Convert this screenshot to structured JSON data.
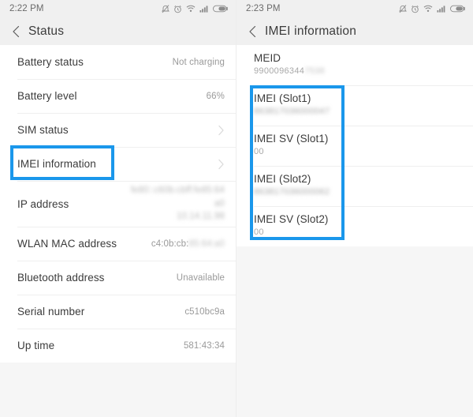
{
  "left_screen": {
    "statusbar": {
      "time": "2:22 PM",
      "icons": [
        "mute-icon",
        "alarm-icon",
        "wifi-icon",
        "signal-icon",
        "battery-icon"
      ]
    },
    "title": "Status",
    "back_label": "back-chevron",
    "rows": [
      {
        "label": "Battery status",
        "value": "Not charging",
        "type": "value"
      },
      {
        "label": "Battery level",
        "value": "66%",
        "type": "value"
      },
      {
        "label": "SIM status",
        "value": "",
        "type": "chevron"
      },
      {
        "label": "IMEI information",
        "value": "",
        "type": "chevron"
      },
      {
        "label": "IP address",
        "value": "",
        "type": "ip"
      },
      {
        "label": "WLAN MAC address",
        "value": "c4:0b:cb:",
        "value_redacted": "85:64:a0",
        "type": "partial"
      },
      {
        "label": "Bluetooth address",
        "value": "Unavailable",
        "type": "value"
      },
      {
        "label": "Serial number",
        "value": "c510bc9a",
        "type": "value"
      },
      {
        "label": "Up time",
        "value": "581:43:34",
        "type": "value"
      }
    ],
    "ip_lines": [
      "fe80::c60b:cbff:fe85:64",
      "a0",
      "10.14.11.98"
    ]
  },
  "right_screen": {
    "statusbar": {
      "time": "2:23 PM",
      "icons": [
        "mute-icon",
        "alarm-icon",
        "wifi-icon",
        "signal-icon",
        "battery-icon"
      ]
    },
    "title": "IMEI  information",
    "back_label": "back-chevron",
    "rows": [
      {
        "label": "MEID",
        "value": "9900096344",
        "value_redacted": "7538",
        "redacted": true
      },
      {
        "label": "IMEI (Slot1)",
        "value": "",
        "value_redacted": "863817036000047",
        "redacted": true
      },
      {
        "label": "IMEI SV (Slot1)",
        "value": "00",
        "value_redacted": "",
        "redacted": false
      },
      {
        "label": "IMEI (Slot2)",
        "value": "",
        "value_redacted": "863817036000062",
        "redacted": true
      },
      {
        "label": "IMEI SV (Slot2)",
        "value": "00",
        "value_redacted": "",
        "redacted": false
      }
    ]
  },
  "highlight": {
    "color": "#1a97eb",
    "left_target": "IMEI information",
    "right_target": "IMEI rows group"
  }
}
